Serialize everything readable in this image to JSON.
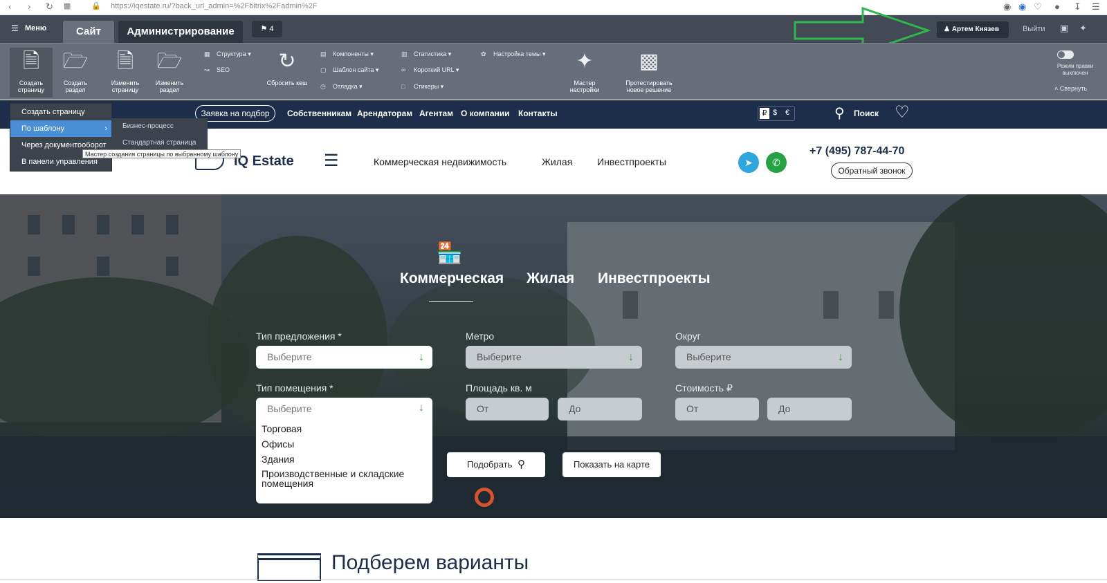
{
  "browser": {
    "url": "https://iqestate.ru/?back_url_admin=%2Fbitrix%2Fadmin%2F",
    "back_icon": "back-arrow-icon",
    "forward_icon": "forward-arrow-icon",
    "reload_icon": "reload-icon"
  },
  "admin": {
    "menu_label": "Меню",
    "tab_site": "Сайт",
    "tab_admin": "Администрирование",
    "notifications_count": "4",
    "user_name": "Артем Князев",
    "logout": "Выйти",
    "tools_big": [
      {
        "label": "Создать страницу",
        "icon": "create-page-icon"
      },
      {
        "label": "Создать раздел",
        "icon": "create-folder-icon"
      },
      {
        "label": "Изменить страницу",
        "icon": "edit-page-icon"
      },
      {
        "label": "Изменить раздел",
        "icon": "edit-folder-icon"
      }
    ],
    "tools_col1": [
      "Структура",
      "SEO"
    ],
    "reset_cache": "Сбросить кеш",
    "tools_col2": [
      "Компоненты",
      "Шаблон сайта",
      "Отладка"
    ],
    "tools_col3": [
      "Статистика",
      "Короткий URL",
      "Стикеры"
    ],
    "theme_settings": "Настройка темы",
    "wizard": "Мастер настройки",
    "test_solution": "Протестировать новое решение",
    "edit_mode": "Режим правки выключен",
    "collapse": "Свернуть",
    "accent_color": "#4a8fd6"
  },
  "create_menu": {
    "items": [
      "Создать страницу",
      "По шаблону",
      "Через документооборот",
      "В панели управления"
    ],
    "submenu": [
      "Бизнес-процесс",
      "Стандартная страница"
    ],
    "tooltip": "Мастер создания страницы по выбранному шаблону"
  },
  "site_nav": {
    "request": "Заявка на подбор",
    "links": [
      "Собственникам",
      "Арендаторам",
      "Агентам",
      "О компании",
      "Контакты"
    ],
    "currencies": [
      "₽",
      "$",
      "€"
    ],
    "search": "Поиск"
  },
  "header": {
    "logo": "IQ Estate",
    "links": [
      "Коммерческая недвижимость",
      "Жилая",
      "Инвестпроекты"
    ],
    "phone": "+7 (495) 787-44-70",
    "callback": "Обратный звонок"
  },
  "hero": {
    "tabs": [
      "Коммерческая",
      "Жилая",
      "Инвестпроекты"
    ],
    "offer_type_label": "Тип предложения *",
    "metro_label": "Метро",
    "district_label": "Округ",
    "select_placeholder": "Выберите",
    "premises_label": "Тип помещения *",
    "area_label": "Площадь кв. м",
    "price_label": "Стоимость ₽",
    "from": "От",
    "to": "До",
    "premises_options": [
      "Торговая",
      "Офисы",
      "Здания",
      "Производственные и складские помещения"
    ],
    "search_button": "Подобрать",
    "map_button": "Показать на карте"
  },
  "section": {
    "title": "Подберем варианты"
  }
}
